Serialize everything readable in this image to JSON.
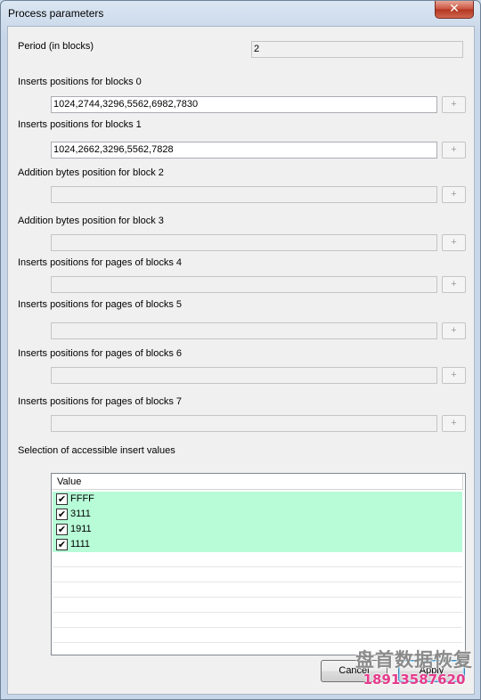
{
  "window": {
    "title": "Process parameters",
    "close_glyph": "✕"
  },
  "period": {
    "label": "Period (in blocks)",
    "value": "2"
  },
  "fields": [
    {
      "label": "Inserts positions for blocks 0",
      "value": "1024,2744,3296,5562,6982,7830",
      "enabled": true,
      "button": "+"
    },
    {
      "label": "Inserts positions for blocks 1",
      "value": "1024,2662,3296,5562,7828",
      "enabled": true,
      "button": "+"
    },
    {
      "label": "Addition bytes position for block 2",
      "value": "",
      "enabled": false,
      "button": "+"
    },
    {
      "label": "Addition bytes position for block 3",
      "value": "",
      "enabled": false,
      "button": "+"
    },
    {
      "label": "Inserts positions for pages of blocks 4",
      "value": "",
      "enabled": false,
      "button": "+"
    },
    {
      "label": "Inserts positions for pages of blocks 5",
      "value": "",
      "enabled": false,
      "button": "+"
    },
    {
      "label": "Inserts positions for pages of blocks 6",
      "value": "",
      "enabled": false,
      "button": "+"
    },
    {
      "label": "Inserts positions for pages of blocks 7",
      "value": "",
      "enabled": false,
      "button": "+"
    }
  ],
  "selection": {
    "label": "Selection of accessible insert values",
    "column_header": "Value",
    "items": [
      {
        "value": "FFFF",
        "checked": true,
        "check_glyph": "✔"
      },
      {
        "value": "3111",
        "checked": true,
        "check_glyph": "✔"
      },
      {
        "value": "1911",
        "checked": true,
        "check_glyph": "✔"
      },
      {
        "value": "1111",
        "checked": true,
        "check_glyph": "✔"
      }
    ],
    "highlight_color": "#b7fcd7"
  },
  "buttons": {
    "cancel": "Cancel",
    "apply": "Apply"
  },
  "watermark": {
    "line1": "盘首数据恢复",
    "line2": "18913587620"
  }
}
